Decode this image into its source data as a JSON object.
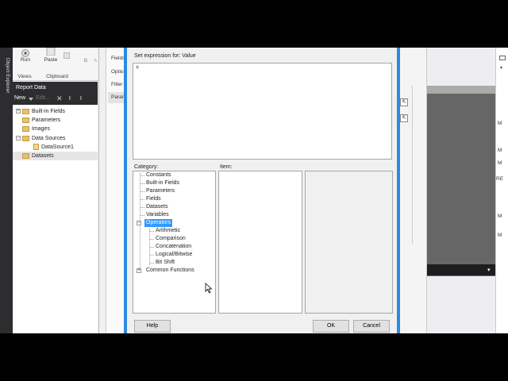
{
  "left_panel": {
    "vertical_label": "Object Explorer"
  },
  "ribbon": {
    "buttons": [
      {
        "label": "Run"
      },
      {
        "label": "Paste"
      }
    ],
    "groups": [
      {
        "label": "Views"
      },
      {
        "label": "Clipboard"
      }
    ],
    "font_buttons": [
      "B",
      "A"
    ]
  },
  "report_data": {
    "title": "Report Data",
    "toolbar": {
      "new_label": "New",
      "edit_label": "Edit..."
    },
    "tree": [
      {
        "label": "Built-in Fields",
        "expander": "+",
        "icon": "folder-icon"
      },
      {
        "label": "Parameters",
        "expander": "",
        "icon": "folder-icon"
      },
      {
        "label": "Images",
        "expander": "",
        "icon": "folder-icon"
      },
      {
        "label": "Data Sources",
        "expander": "−",
        "icon": "folder-icon"
      },
      {
        "label": "DataSource1",
        "expander": "",
        "icon": "datasource-icon"
      },
      {
        "label": "Datasets",
        "expander": "",
        "icon": "folder-icon"
      }
    ]
  },
  "properties_dialog": {
    "tabs": [
      "Fields",
      "Optio",
      "Filter",
      "Param"
    ]
  },
  "designer": {
    "edge_letters": [
      "M",
      "M",
      "M",
      "RE",
      "M",
      "M"
    ]
  },
  "expression_dialog": {
    "set_expression_label": "Set expression for: Value",
    "expression_text": "=",
    "category_label": "Category:",
    "item_label": "Item:",
    "categories": [
      {
        "label": "Constants",
        "level": 0
      },
      {
        "label": "Built-in Fields",
        "level": 0
      },
      {
        "label": "Parameters",
        "level": 0
      },
      {
        "label": "Fields",
        "level": 0
      },
      {
        "label": "Datasets",
        "level": 0
      },
      {
        "label": "Variables",
        "level": 0
      },
      {
        "label": "Operators",
        "level": 0,
        "selected": true,
        "expander": "−"
      },
      {
        "label": "Arithmetic",
        "level": 1
      },
      {
        "label": "Comparison",
        "level": 1
      },
      {
        "label": "Concatenation",
        "level": 1
      },
      {
        "label": "Logical/Bitwise",
        "level": 1
      },
      {
        "label": "Bit Shift",
        "level": 1
      },
      {
        "label": "Common Functions",
        "level": 0,
        "expander": "+"
      }
    ],
    "buttons": {
      "help": "Help",
      "ok": "OK",
      "cancel": "Cancel"
    }
  },
  "colors": {
    "dialog_border": "#2b8ae3",
    "selection": "#3399ff",
    "dark_panel": "#2d2d30"
  }
}
